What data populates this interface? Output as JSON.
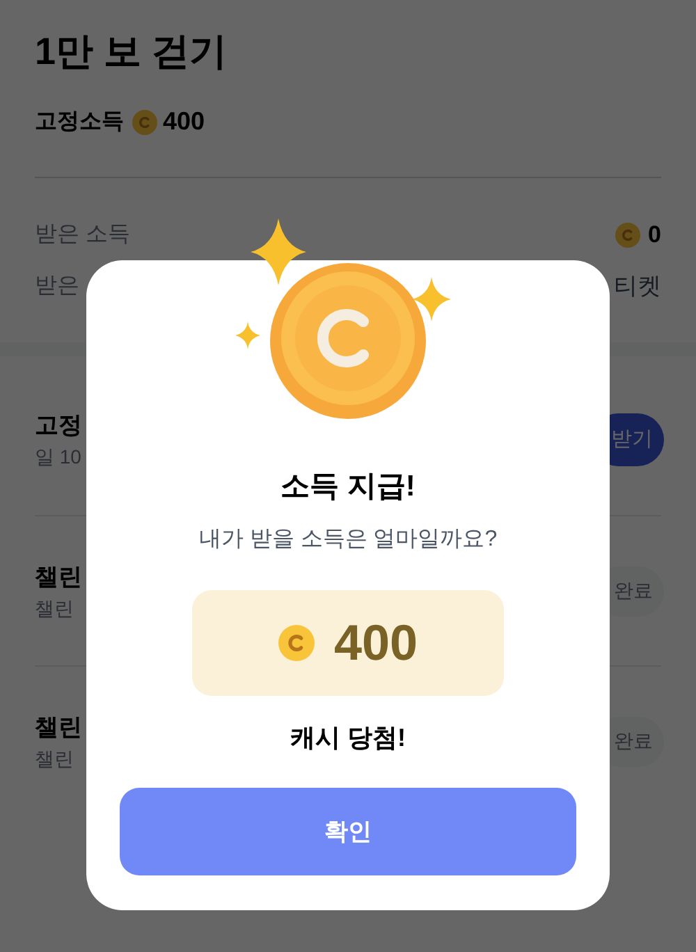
{
  "header": {
    "title": "1만 보 걷기",
    "income_label": "고정소득",
    "income_amount": "400"
  },
  "summary": [
    {
      "kind": "coin",
      "label": "받은 소득",
      "value": "0"
    },
    {
      "kind": "text",
      "label": "받은",
      "value": "티켓"
    }
  ],
  "tasks": [
    {
      "title": "고정",
      "subtitle": "일 10",
      "button": "받기",
      "done": false
    },
    {
      "title": "챌린",
      "subtitle": "챌린",
      "button": "완료",
      "done": true
    },
    {
      "title": "챌린",
      "subtitle": "챌린",
      "button": "완료",
      "done": true
    }
  ],
  "dialog": {
    "title": "소득 지급!",
    "message": "내가 받을 소득은 얼마일까요?",
    "amount": "400",
    "result": "캐시 당첨!",
    "confirm": "확인"
  }
}
